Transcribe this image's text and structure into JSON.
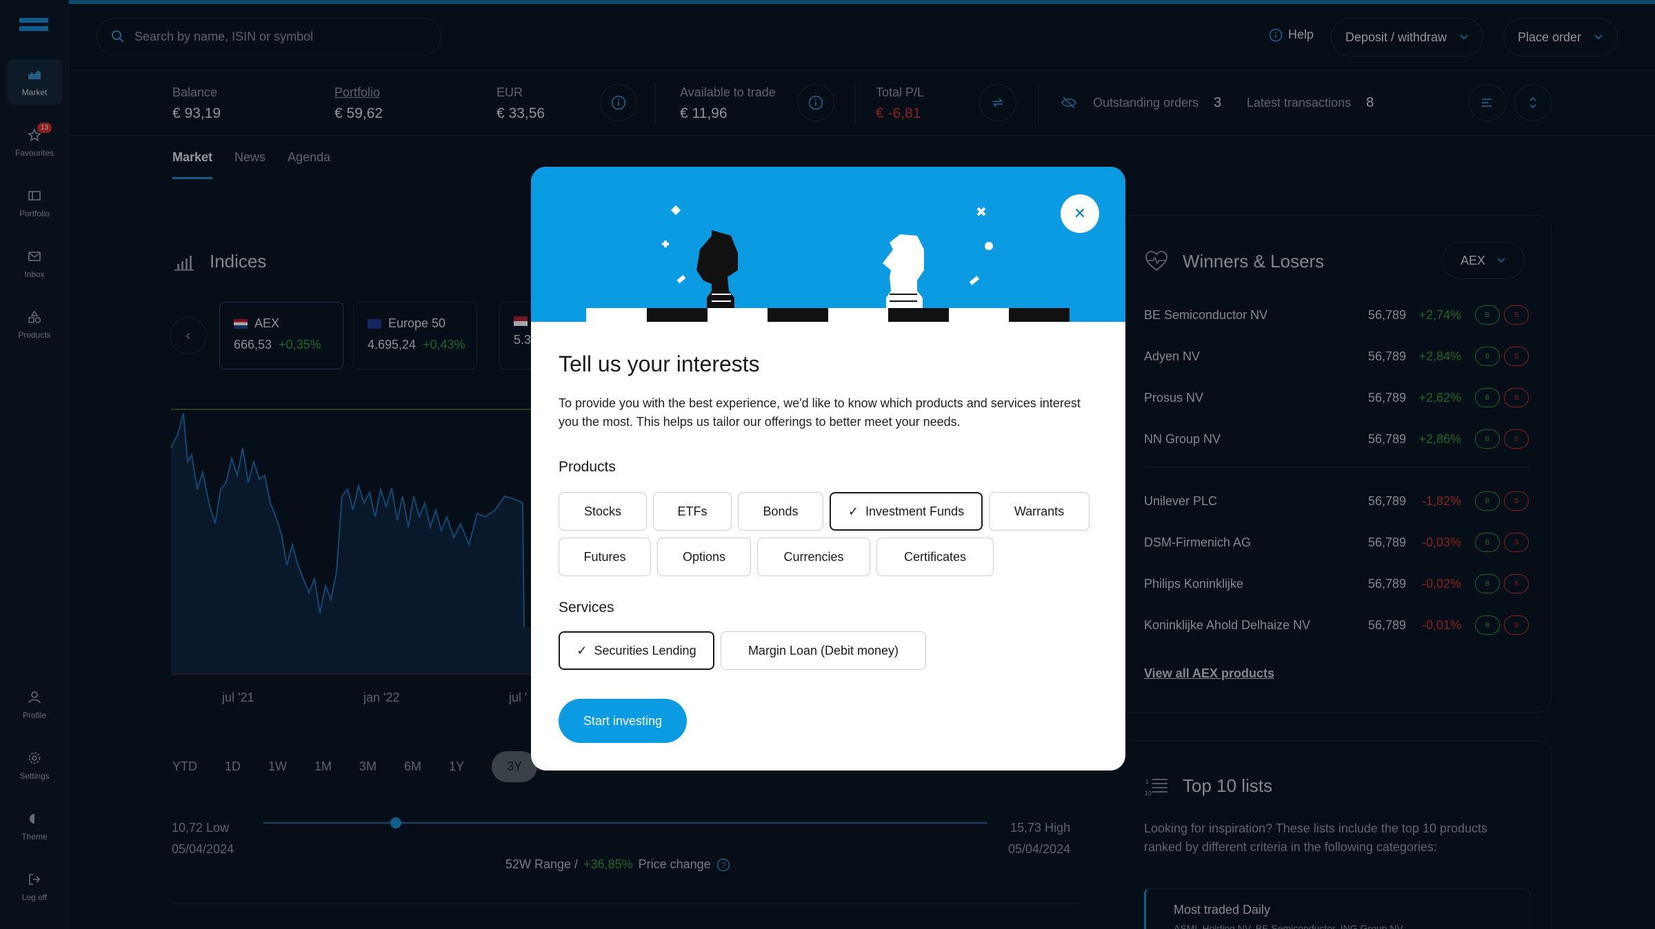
{
  "search": {
    "placeholder": "Search by name, ISIN or symbol"
  },
  "header": {
    "help": "Help",
    "deposit": "Deposit / withdraw",
    "place_order": "Place order"
  },
  "sidebar": {
    "items": [
      {
        "label": "Market",
        "icon": "market-icon"
      },
      {
        "label": "Favourites",
        "icon": "star-icon",
        "badge": "13"
      },
      {
        "label": "Portfolio",
        "icon": "portfolio-icon"
      },
      {
        "label": "Inbox",
        "icon": "inbox-icon"
      },
      {
        "label": "Products",
        "icon": "products-icon"
      },
      {
        "label": "Profile",
        "icon": "profile-icon"
      },
      {
        "label": "Settings",
        "icon": "gear-icon"
      },
      {
        "label": "Theme",
        "icon": "theme-icon"
      },
      {
        "label": "Log off",
        "icon": "logoff-icon"
      }
    ]
  },
  "balances": {
    "balance_label": "Balance",
    "balance_value": "€ 93,19",
    "portfolio_label": "Portfolio",
    "portfolio_value": "€ 59,62",
    "eur_label": "EUR",
    "eur_value": "€ 33,56",
    "available_label": "Available to trade",
    "available_value": "€ 11,96",
    "pl_label": "Total P/L",
    "pl_value": "€ -6,81",
    "outstanding_label": "Outstanding orders",
    "outstanding_value": "3",
    "transactions_label": "Latest transactions",
    "transactions_value": "8"
  },
  "tabs": [
    "Market",
    "News",
    "Agenda"
  ],
  "indices": {
    "title": "Indices",
    "cards": [
      {
        "name": "AEX",
        "value": "666,53",
        "change": "+0,35%"
      },
      {
        "name": "Europe 50",
        "value": "4.695,24",
        "change": "+0,43%"
      },
      {
        "name": "",
        "value": "5.3",
        "change": ""
      }
    ],
    "x_labels": [
      "jul '21",
      "jan '22",
      "jul '"
    ],
    "ranges": [
      "YTD",
      "1D",
      "1W",
      "1M",
      "3M",
      "6M",
      "1Y",
      "3Y"
    ],
    "low_value": "10,72 Low",
    "low_date": "05/04/2024",
    "high_value": "15,73 High",
    "high_date": "05/04/2024",
    "range_text": "52W Range /",
    "price_change": "+36,85%",
    "price_change_label": "Price change"
  },
  "winners": {
    "title": "Winners & Losers",
    "dropdown": "AEX",
    "rows": [
      {
        "name": "BE Semiconductor NV",
        "price": "56,789",
        "change": "+2,74%",
        "dir": "up"
      },
      {
        "name": "Adyen NV",
        "price": "56,789",
        "change": "+2,84%",
        "dir": "up"
      },
      {
        "name": "Prosus NV",
        "price": "56,789",
        "change": "+2,62%",
        "dir": "up"
      },
      {
        "name": "NN Group NV",
        "price": "56,789",
        "change": "+2,86%",
        "dir": "up"
      },
      {
        "name": "Unilever PLC",
        "price": "56,789",
        "change": "-1,82%",
        "dir": "down"
      },
      {
        "name": "DSM-Firmenich AG",
        "price": "56,789",
        "change": "-0,03%",
        "dir": "down"
      },
      {
        "name": "Philips Koninklijke",
        "price": "56,789",
        "change": "-0,02%",
        "dir": "down"
      },
      {
        "name": "Koninklijke Ahold Delhaize NV",
        "price": "56,789",
        "change": "-0,01%",
        "dir": "down"
      }
    ],
    "buy": "B",
    "sell": "S",
    "view_all": "View all AEX products"
  },
  "top10": {
    "title": "Top 10 lists",
    "desc": "Looking for inspiration? These lists include the top 10 products ranked by different criteria in the following categories:",
    "first_item": "Most traded Daily",
    "first_item_sub": "ASML Holding NV, BE Semiconductor, ING Group NV"
  },
  "modal": {
    "title": "Tell us your interests",
    "description": "To provide you with the best experience, we'd like to know which products and services interest you the most. This helps us tailor our offerings to better meet your needs.",
    "products_title": "Products",
    "products": [
      "Stocks",
      "ETFs",
      "Bonds",
      "Investment Funds",
      "Warrants",
      "Futures",
      "Options",
      "Currencies",
      "Certificates"
    ],
    "products_selected": [
      "Investment Funds"
    ],
    "services_title": "Services",
    "services": [
      "Securities Lending",
      "Margin Loan (Debit money)"
    ],
    "services_selected": [
      "Securities Lending"
    ],
    "cta": "Start investing"
  },
  "colors": {
    "accent": "#0b9be3",
    "positive": "#2f9e44",
    "negative": "#d6342f",
    "background": "#0a1624"
  }
}
